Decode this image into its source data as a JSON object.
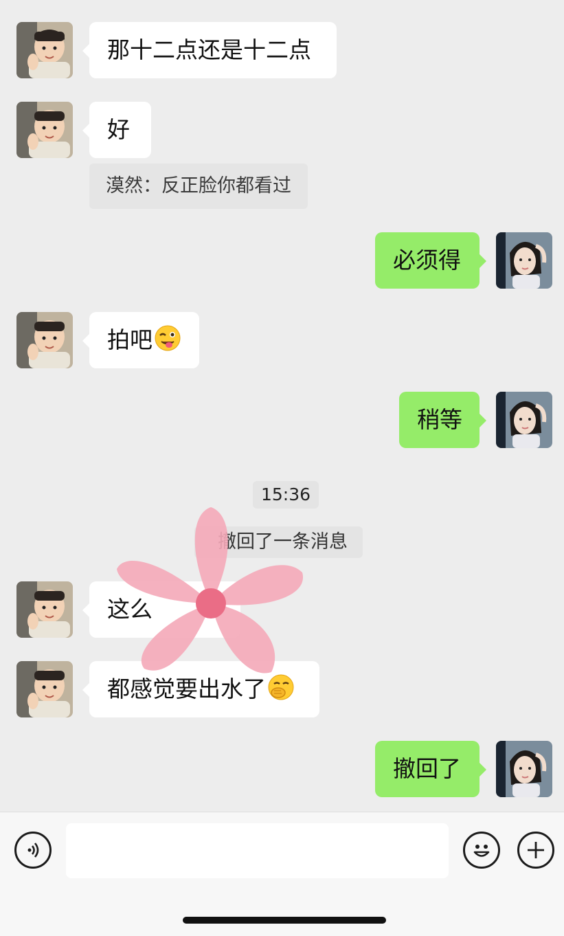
{
  "messages": [
    {
      "sender": "contact",
      "text": "那十二点还是十二点"
    },
    {
      "sender": "contact",
      "text": "好"
    },
    {
      "sender": "contact_quote",
      "text": "漠然：反正脸你都看过"
    },
    {
      "sender": "me",
      "text": "必须得"
    },
    {
      "sender": "contact",
      "text": "拍吧",
      "emoji": "winking-tongue-emoji"
    },
    {
      "sender": "me",
      "text": "稍等"
    },
    {
      "sender": "contact",
      "text": "这么",
      "obscured": true
    },
    {
      "sender": "contact",
      "text": "都感觉要出水了",
      "emoji": "face-with-hand-over-mouth-emoji"
    },
    {
      "sender": "me",
      "text": "撤回了"
    }
  ],
  "timestamp": "15:36",
  "system_notice": "撤回了一条消息",
  "overlay": {
    "type": "sticker",
    "icon": "pink-flower-sticker",
    "color": "#f4a9b8",
    "center_color": "#ea6d86"
  },
  "input_bar": {
    "voice_icon": "voice-icon",
    "emoji_icon": "emoji-icon",
    "more_icon": "plus-icon",
    "placeholder": ""
  },
  "colors": {
    "background": "#ededed",
    "outgoing_bubble": "#95ec69",
    "incoming_bubble": "#ffffff"
  }
}
